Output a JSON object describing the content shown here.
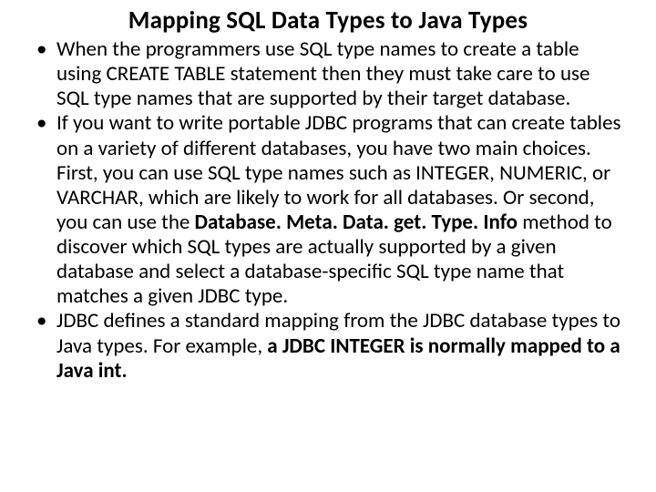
{
  "slide": {
    "title": "Mapping SQL Data Types to Java Types",
    "bullets": [
      {
        "text": "When the programmers use SQL type names to create a table using CREATE TABLE statement then they must take care to use SQL type names that are supported by their target database."
      },
      {
        "pre": "If you want to write portable JDBC programs that can create tables on a variety of different databases, you have two main choices. First, you can use  SQL type names such as INTEGER, NUMERIC, or VARCHAR, which are likely to work for all databases. Or second, you can use the ",
        "bold": "Database. Meta. Data. get. Type. Info",
        "post": " method to discover which SQL types are actually supported by a given database and select a database-specific SQL type name that matches a given JDBC type."
      },
      {
        "pre": "JDBC defines a standard mapping from the JDBC database types to Java types. For example, ",
        "bold": "a JDBC INTEGER is normally mapped to a Java int."
      }
    ]
  }
}
